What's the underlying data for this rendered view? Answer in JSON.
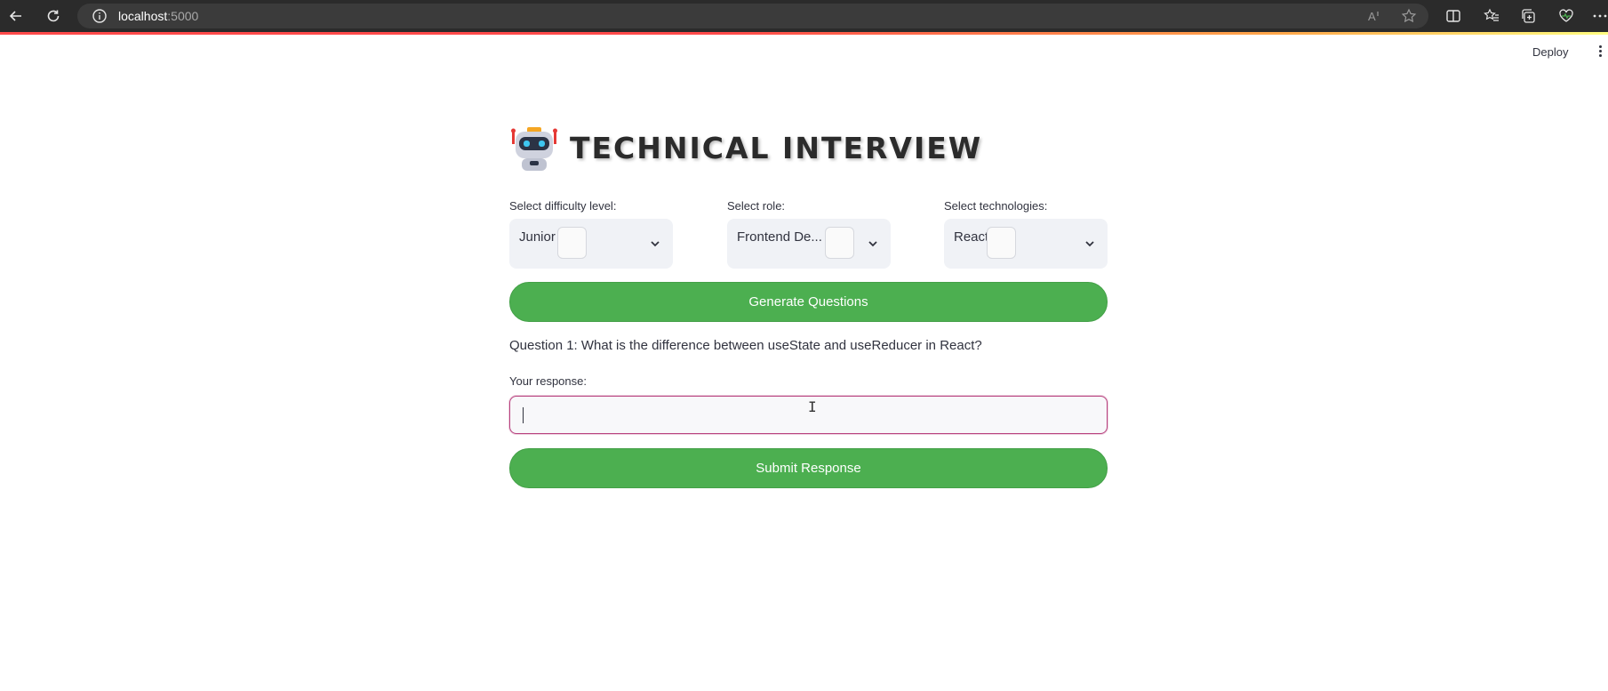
{
  "browser": {
    "url_host": "localhost",
    "url_port": ":5000",
    "icons": [
      "back-icon",
      "refresh-icon",
      "info-icon",
      "read-aloud-icon",
      "favorite-icon",
      "split-screen-icon",
      "favorites-icon",
      "collections-icon",
      "browser-essentials-icon",
      "more-icon"
    ],
    "loadbar_colors": [
      "#ff4b4b",
      "#ffa94b",
      "#fffd80"
    ]
  },
  "toolbar": {
    "deploy_label": "Deploy"
  },
  "header": {
    "title": "TECHNICAL INTERVIEW",
    "icon": "robot-icon"
  },
  "filters": {
    "difficulty": {
      "label": "Select difficulty level:",
      "value": "Junior"
    },
    "role": {
      "label": "Select role:",
      "value": "Frontend De..."
    },
    "technologies": {
      "label": "Select technologies:",
      "value": "React"
    }
  },
  "actions": {
    "generate_label": "Generate Questions",
    "submit_label": "Submit Response",
    "button_color": "#4caf50"
  },
  "question": {
    "text": "Question 1: What is the difference between useState and useReducer in React?"
  },
  "response": {
    "label": "Your response:",
    "value": "",
    "focus_color": "#b8437f"
  }
}
